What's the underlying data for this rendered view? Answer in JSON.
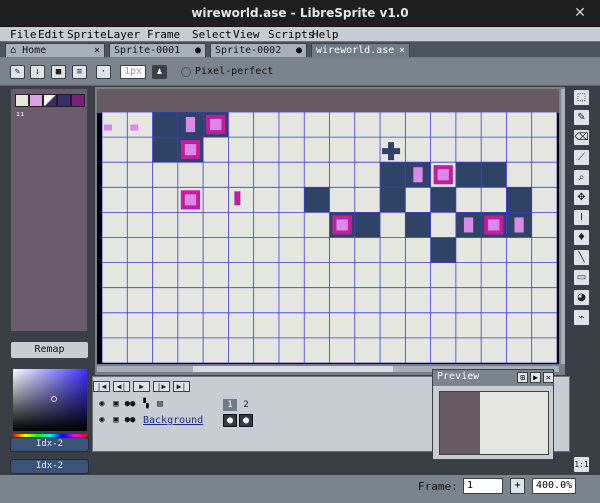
{
  "window": {
    "title": "wireworld.ase - LibreSprite v1.0",
    "close_icon": "close-icon"
  },
  "menu": [
    {
      "label": "File"
    },
    {
      "label": "Edit"
    },
    {
      "label": "Sprite"
    },
    {
      "label": "Layer"
    },
    {
      "label": "Frame"
    },
    {
      "label": "Select"
    },
    {
      "label": "View"
    },
    {
      "label": "Scripts"
    },
    {
      "label": "Help"
    }
  ],
  "tabs": [
    {
      "label": "Home",
      "close": "×"
    },
    {
      "label": "Sprite-0001",
      "close": "●"
    },
    {
      "label": "Sprite-0002",
      "close": "●"
    },
    {
      "label": "wireworld.ase",
      "close": "×"
    }
  ],
  "toolbar": {
    "brush_size": "1px",
    "pixel_perfect_label": "Pixel-perfect"
  },
  "palette": {
    "swatches": [
      "#e6e6e0",
      "#d9a0e8",
      "#ffffff",
      "#3b2b6b",
      "#7b1e7b"
    ],
    "remap_label": "Remap",
    "fg_label": "Idx-2",
    "bg_label": "Idx-2"
  },
  "canvas": {
    "colors": {
      "bg": "#e6e6e0",
      "grid": "#3b3bd9",
      "wire": "#2f4366",
      "head": "#c31d9e",
      "tail": "#d98ae8",
      "top": "#655962"
    },
    "grid_cols": 18,
    "grid_rows": 10
  },
  "timeline": {
    "layer_name": "Background",
    "frames": [
      "1",
      "2"
    ]
  },
  "preview": {
    "title": "Preview"
  },
  "status": {
    "frame_label": "Frame:",
    "frame_value": "1",
    "zoom": "400.0%"
  }
}
